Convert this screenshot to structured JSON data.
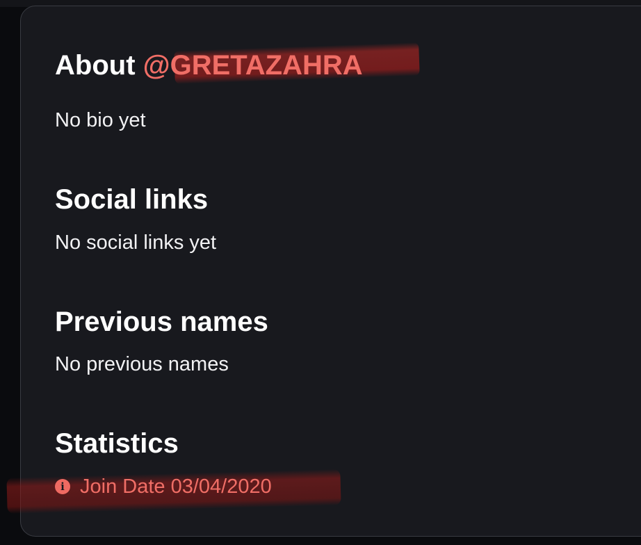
{
  "about": {
    "title_prefix": "About ",
    "username": "@GRETAZAHRA",
    "bio": "No bio yet"
  },
  "social_links": {
    "title": "Social links",
    "empty_text": "No social links yet"
  },
  "previous_names": {
    "title": "Previous names",
    "empty_text": "No previous names"
  },
  "statistics": {
    "title": "Statistics",
    "join_date_label": "Join Date 03/04/2020",
    "info_icon": "info-icon"
  },
  "colors": {
    "card_background": "#18191e",
    "accent": "#f06e66",
    "text": "#ffffff"
  }
}
